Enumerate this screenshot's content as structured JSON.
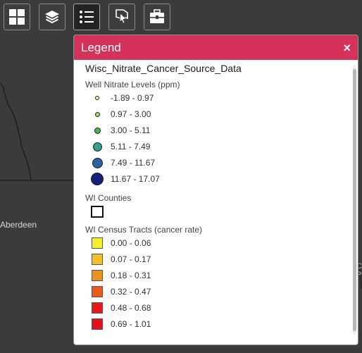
{
  "map": {
    "place_label": "Aberdeen",
    "edge_label_chars": [
      "C",
      "P"
    ]
  },
  "toolbar": {
    "buttons": [
      {
        "icon": "grid-icon"
      },
      {
        "icon": "layers-icon"
      },
      {
        "icon": "legend-list-icon",
        "active": true
      },
      {
        "icon": "map-pointer-icon"
      },
      {
        "icon": "toolbox-icon"
      }
    ]
  },
  "legend": {
    "title": "Legend",
    "close_label": "×",
    "layer_title": "Wisc_Nitrate_Cancer_Source_Data",
    "nitrate": {
      "title": "Well Nitrate Levels (ppm)",
      "items": [
        {
          "label": "-1.89 - 0.97",
          "color": "#f2f59a"
        },
        {
          "label": "0.97 - 3.00",
          "color": "#a4dd68"
        },
        {
          "label": "3.00 - 5.11",
          "color": "#4cb74a"
        },
        {
          "label": "5.11 - 7.49",
          "color": "#31a08e"
        },
        {
          "label": "7.49 - 11.67",
          "color": "#2d62a8"
        },
        {
          "label": "11.67 - 17.07",
          "color": "#16207c"
        }
      ]
    },
    "counties": {
      "title": "WI Counties"
    },
    "tracts": {
      "title": "WI Census Tracts (cancer rate)",
      "items": [
        {
          "label": "0.00 - 0.06",
          "color": "#f5ef2f"
        },
        {
          "label": "0.07 - 0.17",
          "color": "#f3bf2a"
        },
        {
          "label": "0.18 - 0.31",
          "color": "#f08f22"
        },
        {
          "label": "0.32 - 0.47",
          "color": "#ec5a1b"
        },
        {
          "label": "0.48 - 0.68",
          "color": "#e8191b"
        },
        {
          "label": "0.69 - 1.01",
          "color": "#e4101e"
        }
      ]
    }
  },
  "colors": {
    "header": "#d4325a",
    "map_background": "#3b3b3d"
  }
}
